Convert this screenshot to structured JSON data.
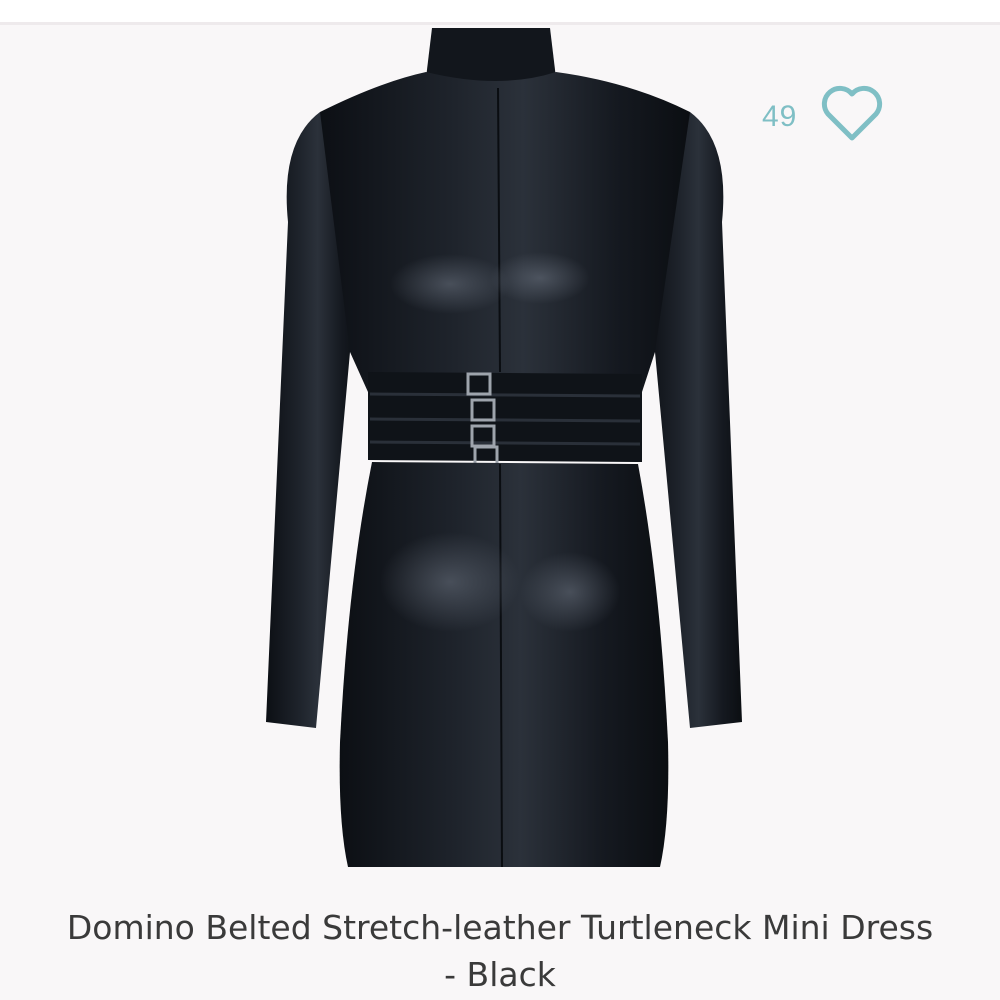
{
  "listing": {
    "like_count": "49",
    "like_icon": "heart-outline-icon",
    "accent_color": "#7fbfc5",
    "image_subject": "black belted leather turtleneck mini dress",
    "title": "Domino Belted Stretch-leather Turtleneck Mini Dress - Black"
  }
}
